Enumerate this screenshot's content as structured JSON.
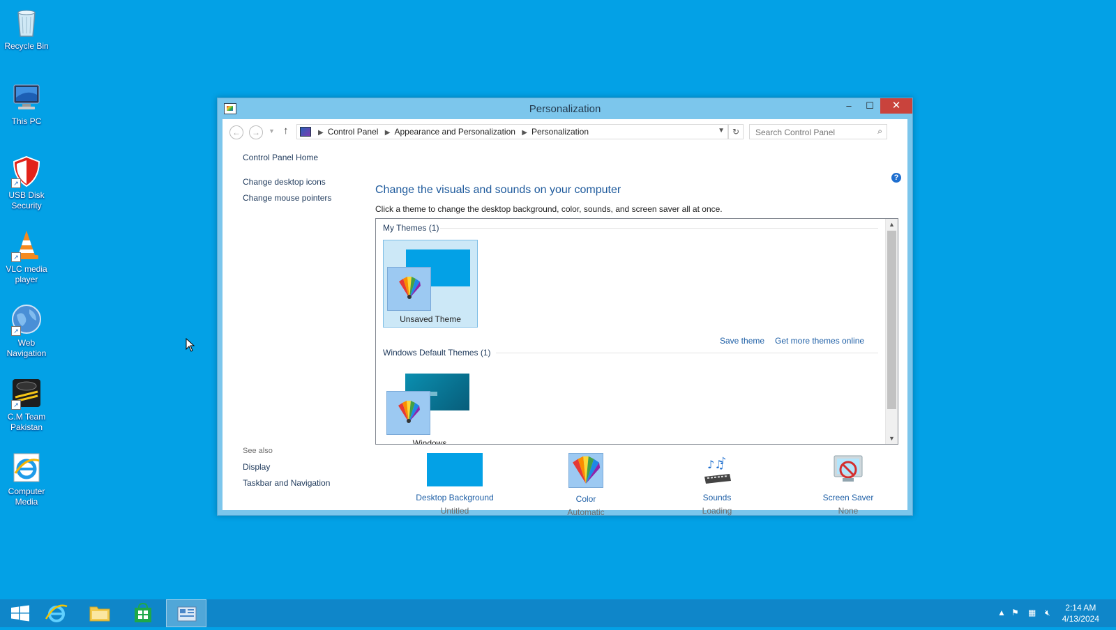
{
  "desktop": {
    "icons": [
      {
        "label": "Recycle Bin"
      },
      {
        "label": "This PC"
      },
      {
        "label": "USB Disk Security"
      },
      {
        "label": "VLC media player"
      },
      {
        "label": "Web Navigation"
      },
      {
        "label": "C.M Team Pakistan"
      },
      {
        "label": "Computer Media"
      }
    ]
  },
  "window": {
    "title": "Personalization",
    "minimize": "–",
    "maximize": "☐",
    "close": "✕"
  },
  "address": {
    "crumbs": [
      "Control Panel",
      "Appearance and Personalization",
      "Personalization"
    ],
    "search_placeholder": "Search Control Panel"
  },
  "left_pane": {
    "home": "Control Panel Home",
    "links": [
      "Change desktop icons",
      "Change mouse pointers"
    ],
    "see_also_header": "See also",
    "see_also": [
      "Display",
      "Taskbar and Navigation"
    ]
  },
  "main": {
    "heading": "Change the visuals and sounds on your computer",
    "subtext": "Click a theme to change the desktop background, color, sounds, and screen saver all at once.",
    "my_themes_header": "My Themes (1)",
    "my_themes": [
      {
        "label": "Unsaved Theme"
      }
    ],
    "save_theme": "Save theme",
    "get_more": "Get more themes online",
    "default_themes_header": "Windows Default Themes (1)",
    "default_themes": [
      {
        "label": "Windows"
      }
    ]
  },
  "bottom_items": [
    {
      "label": "Desktop Background",
      "value": "Untitled"
    },
    {
      "label": "Color",
      "value": "Automatic"
    },
    {
      "label": "Sounds",
      "value": "Loading"
    },
    {
      "label": "Screen Saver",
      "value": "None"
    }
  ],
  "taskbar": {
    "time": "2:14 AM",
    "date": "4/13/2024"
  },
  "colors": {
    "desktop": "#03a1e6",
    "taskbar": "#0f86c9",
    "window_frame": "#7cc6ec",
    "link": "#1e5fa6",
    "close_button": "#c9433c"
  }
}
